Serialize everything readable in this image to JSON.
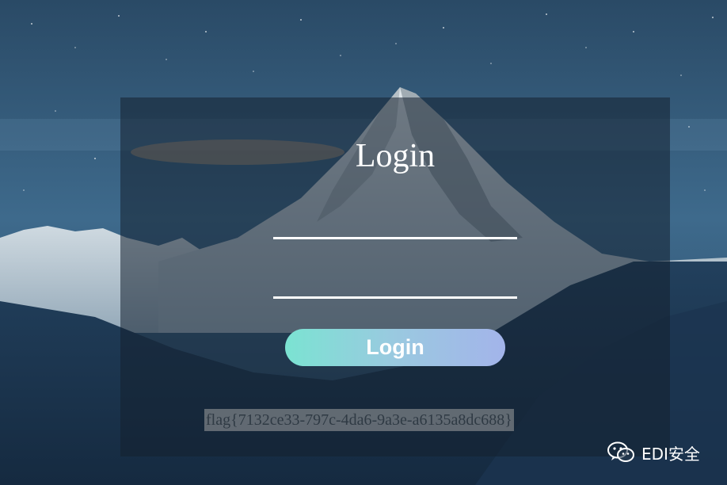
{
  "login": {
    "title": "Login",
    "username_value": "",
    "password_value": "",
    "button_label": "Login"
  },
  "flag_text": "flag{7132ce33-797c-4da6-9a3e-a6135a8dc688}",
  "watermark": {
    "icon": "wechat-icon",
    "text": "EDI安全"
  },
  "colors": {
    "button_gradient_start": "#7be3d2",
    "button_gradient_end": "#a3b4ea",
    "panel_overlay": "rgba(20,32,48,0.55)",
    "field_underline": "#ffffff"
  }
}
